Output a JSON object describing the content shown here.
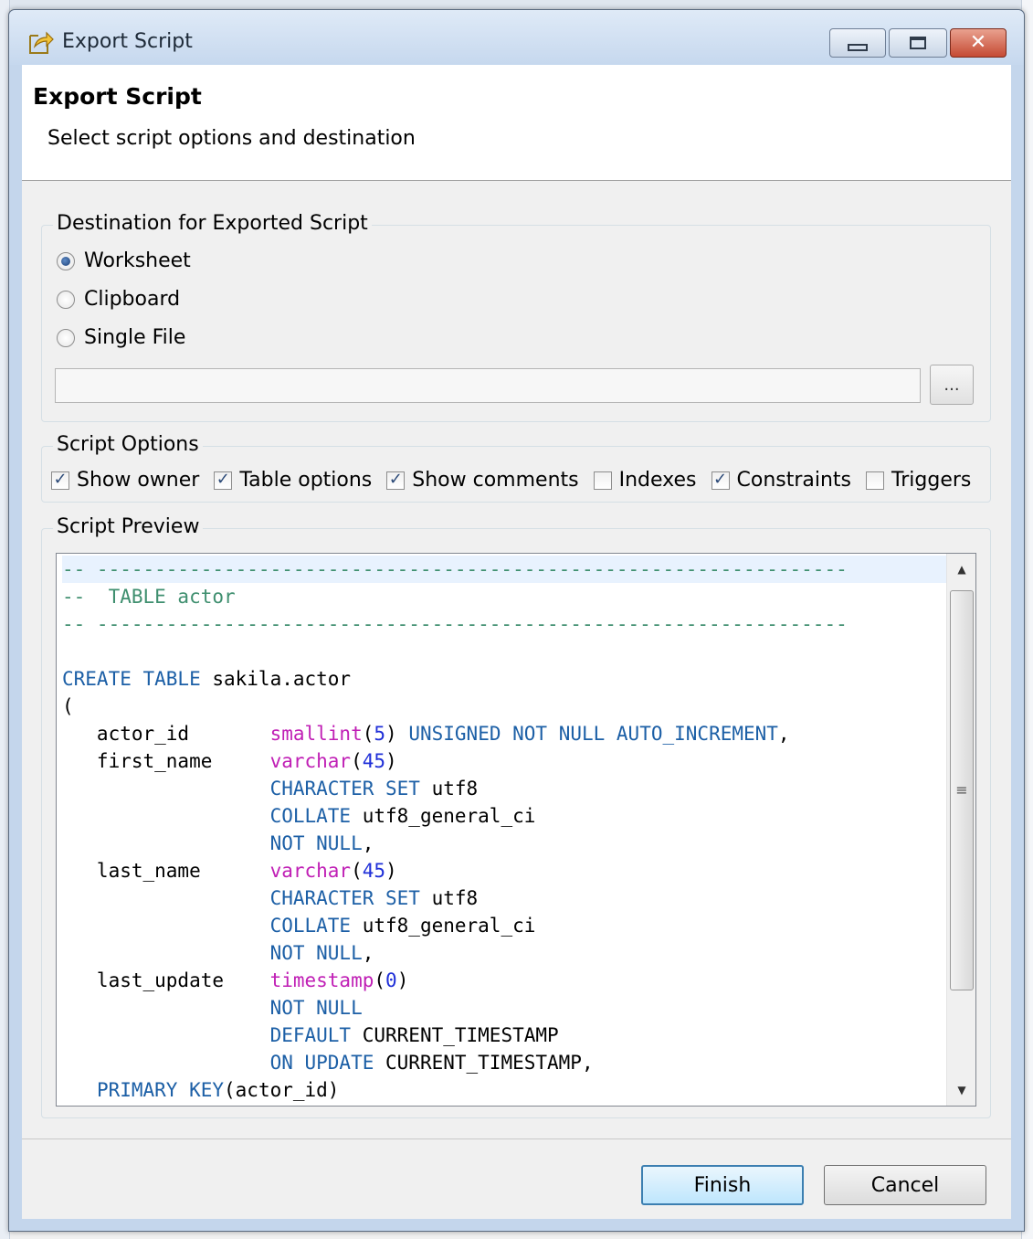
{
  "window": {
    "title": "Export Script",
    "buttons": {
      "minimize": "minimize",
      "maximize": "maximize",
      "close": "close"
    }
  },
  "header": {
    "title": "Export Script",
    "subtitle": "Select script options and destination"
  },
  "destination": {
    "legend": "Destination for Exported Script",
    "options": [
      "Worksheet",
      "Clipboard",
      "Single File"
    ],
    "selected": "Worksheet",
    "file_path_value": "",
    "browse_label": "..."
  },
  "script_options": {
    "legend": "Script Options",
    "items": [
      {
        "label": "Show owner",
        "checked": true
      },
      {
        "label": "Table options",
        "checked": true
      },
      {
        "label": "Show comments",
        "checked": true
      },
      {
        "label": "Indexes",
        "checked": false
      },
      {
        "label": "Constraints",
        "checked": true
      },
      {
        "label": "Triggers",
        "checked": false
      }
    ]
  },
  "preview": {
    "legend": "Script Preview",
    "lines": [
      [
        [
          "cm",
          "-- -----------------------------------------------------------------"
        ]
      ],
      [
        [
          "cm",
          "--  TABLE actor"
        ]
      ],
      [
        [
          "cm",
          "-- -----------------------------------------------------------------"
        ]
      ],
      [],
      [
        [
          "kw",
          "CREATE TABLE"
        ],
        [
          "tx",
          " sakila.actor"
        ]
      ],
      [
        [
          "tx",
          "("
        ]
      ],
      [
        [
          "tx",
          "   actor_id       "
        ],
        [
          "ty",
          "smallint"
        ],
        [
          "tx",
          "("
        ],
        [
          "num",
          "5"
        ],
        [
          "tx",
          ") "
        ],
        [
          "kw",
          "UNSIGNED NOT NULL AUTO_INCREMENT"
        ],
        [
          "tx",
          ","
        ]
      ],
      [
        [
          "tx",
          "   first_name     "
        ],
        [
          "ty",
          "varchar"
        ],
        [
          "tx",
          "("
        ],
        [
          "num",
          "45"
        ],
        [
          "tx",
          ")"
        ]
      ],
      [
        [
          "tx",
          "                  "
        ],
        [
          "kw",
          "CHARACTER SET"
        ],
        [
          "tx",
          " utf8"
        ]
      ],
      [
        [
          "tx",
          "                  "
        ],
        [
          "kw",
          "COLLATE"
        ],
        [
          "tx",
          " utf8_general_ci"
        ]
      ],
      [
        [
          "tx",
          "                  "
        ],
        [
          "kw",
          "NOT NULL"
        ],
        [
          "tx",
          ","
        ]
      ],
      [
        [
          "tx",
          "   last_name      "
        ],
        [
          "ty",
          "varchar"
        ],
        [
          "tx",
          "("
        ],
        [
          "num",
          "45"
        ],
        [
          "tx",
          ")"
        ]
      ],
      [
        [
          "tx",
          "                  "
        ],
        [
          "kw",
          "CHARACTER SET"
        ],
        [
          "tx",
          " utf8"
        ]
      ],
      [
        [
          "tx",
          "                  "
        ],
        [
          "kw",
          "COLLATE"
        ],
        [
          "tx",
          " utf8_general_ci"
        ]
      ],
      [
        [
          "tx",
          "                  "
        ],
        [
          "kw",
          "NOT NULL"
        ],
        [
          "tx",
          ","
        ]
      ],
      [
        [
          "tx",
          "   last_update    "
        ],
        [
          "ty",
          "timestamp"
        ],
        [
          "tx",
          "("
        ],
        [
          "num",
          "0"
        ],
        [
          "tx",
          ")"
        ]
      ],
      [
        [
          "tx",
          "                  "
        ],
        [
          "kw",
          "NOT NULL"
        ]
      ],
      [
        [
          "tx",
          "                  "
        ],
        [
          "kw",
          "DEFAULT"
        ],
        [
          "tx",
          " CURRENT_TIMESTAMP"
        ]
      ],
      [
        [
          "tx",
          "                  "
        ],
        [
          "kw",
          "ON UPDATE"
        ],
        [
          "tx",
          " CURRENT_TIMESTAMP,"
        ]
      ],
      [
        [
          "tx",
          "   "
        ],
        [
          "kw",
          "PRIMARY KEY"
        ],
        [
          "tx",
          "(actor_id)"
        ]
      ]
    ]
  },
  "footer": {
    "finish_label": "Finish",
    "cancel_label": "Cancel"
  },
  "colors": {
    "comment": "#3f8f6f",
    "keyword": "#1c5fa6",
    "type": "#c01fb5",
    "number": "#1f2fd8",
    "highlight_line": "#e8f2fe"
  }
}
